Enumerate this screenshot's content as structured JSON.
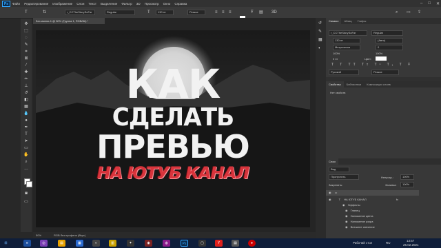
{
  "menu": [
    "Файл",
    "Редактирование",
    "Изображение",
    "Слои",
    "Текст",
    "Выделение",
    "Фильтр",
    "3D",
    "Просмотр",
    "Окно",
    "Справка"
  ],
  "options": {
    "font_family": "r_CCTheStorySoFar",
    "font_style": "Regular",
    "font_size": "130 пт",
    "aa": "Резкое"
  },
  "document": {
    "tab_title": "Без имени-1 @ 50% (Группа 1, RGB/8#) *",
    "zoom": "50%",
    "profile": "RGB без профиля (8bpc)"
  },
  "canvas": {
    "line1": "КАК",
    "line2": "СДЕЛАТЬ",
    "line3": "ПРЕВЬЮ",
    "line4": "НА ЮТУБ КАНАЛ"
  },
  "character_panel": {
    "tabs": [
      "Символ",
      "Абзац",
      "Глифы"
    ],
    "font": "r_CCTheStorySoFar",
    "style": "Regular",
    "size": "130 пт",
    "leading": "(Авто)",
    "tracking_label": "Метрически",
    "tracking": "0",
    "scale_v": "100%",
    "scale_h": "100%",
    "baseline": "0 пт",
    "color_label": "Цвет:",
    "language": "Русский",
    "aa": "Резкое"
  },
  "props_panel": {
    "tabs": [
      "Свойства",
      "Библиотеки",
      "Композиции слоев"
    ],
    "empty": "Нет свойств"
  },
  "layers_panel": {
    "tabs": [
      "Слои"
    ],
    "kind": "Вид",
    "blend": "Пропустить",
    "opacity_label": "Непрозр.:",
    "opacity": "100%",
    "lock_label": "Закрепить:",
    "fill_label": "Заливка:",
    "fill": "100%",
    "items": [
      {
        "name": "",
        "type": "group"
      },
      {
        "name": "НА ЮТУБ КАНАЛ",
        "type": "text"
      },
      {
        "name": "Эффекты",
        "type": "fx"
      },
      {
        "name": "Глянец",
        "type": "effect"
      },
      {
        "name": "Наложение цвета",
        "type": "effect"
      },
      {
        "name": "Наложение узора",
        "type": "effect"
      },
      {
        "name": "Внешнее свечение",
        "type": "effect"
      }
    ]
  },
  "taskbar": {
    "desktop_label": "Рабочий стол",
    "lang": "RU",
    "time": "13:57",
    "date": "25.02.2021"
  },
  "colors": {
    "accent_red": "#d8343c",
    "ps_blue": "#31a8ff"
  }
}
